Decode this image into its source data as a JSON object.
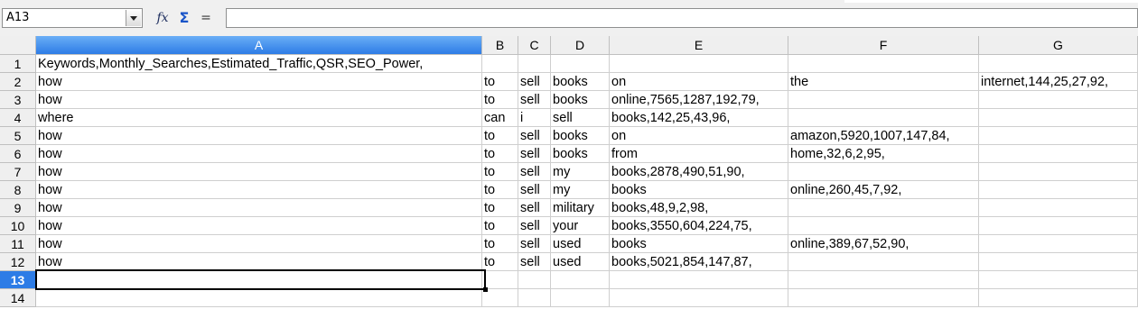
{
  "name_box": {
    "value": "A13"
  },
  "toolbar": {
    "fx_icon": "function-wizard-icon",
    "sum_icon": "sum-icon",
    "eq_icon": "equals-icon",
    "eq_label": "="
  },
  "formula": {
    "value": ""
  },
  "active_cell": "A13",
  "columns": [
    "A",
    "B",
    "C",
    "D",
    "E",
    "F",
    "G"
  ],
  "rows": [
    {
      "num": "1",
      "cells": [
        "Keywords,Monthly_Searches,Estimated_Traffic,QSR,SEO_Power,",
        "",
        "",
        "",
        "",
        "",
        ""
      ]
    },
    {
      "num": "2",
      "cells": [
        "how",
        "to",
        "sell",
        "books",
        "on",
        "the",
        "internet,144,25,27,92,"
      ]
    },
    {
      "num": "3",
      "cells": [
        "how",
        "to",
        "sell",
        "books",
        "online,7565,1287,192,79,",
        "",
        ""
      ]
    },
    {
      "num": "4",
      "cells": [
        "where",
        "can",
        "i",
        "sell",
        "books,142,25,43,96,",
        "",
        ""
      ]
    },
    {
      "num": "5",
      "cells": [
        "how",
        "to",
        "sell",
        "books",
        "on",
        "amazon,5920,1007,147,84,",
        ""
      ]
    },
    {
      "num": "6",
      "cells": [
        "how",
        "to",
        "sell",
        "books",
        "from",
        "home,32,6,2,95,",
        ""
      ]
    },
    {
      "num": "7",
      "cells": [
        "how",
        "to",
        "sell",
        "my",
        "books,2878,490,51,90,",
        "",
        ""
      ]
    },
    {
      "num": "8",
      "cells": [
        "how",
        "to",
        "sell",
        "my",
        "books",
        "online,260,45,7,92,",
        ""
      ]
    },
    {
      "num": "9",
      "cells": [
        "how",
        "to",
        "sell",
        "military",
        "books,48,9,2,98,",
        "",
        ""
      ]
    },
    {
      "num": "10",
      "cells": [
        "how",
        "to",
        "sell",
        "your",
        "books,3550,604,224,75,",
        "",
        ""
      ]
    },
    {
      "num": "11",
      "cells": [
        "how",
        "to",
        "sell",
        "used",
        "books",
        "online,389,67,52,90,",
        ""
      ]
    },
    {
      "num": "12",
      "cells": [
        "how",
        "to",
        "sell",
        "used",
        "books,5021,854,147,87,",
        "",
        ""
      ]
    },
    {
      "num": "13",
      "cells": [
        "",
        "",
        "",
        "",
        "",
        "",
        ""
      ]
    },
    {
      "num": "14",
      "cells": [
        "",
        "",
        "",
        "",
        "",
        "",
        ""
      ]
    }
  ]
}
